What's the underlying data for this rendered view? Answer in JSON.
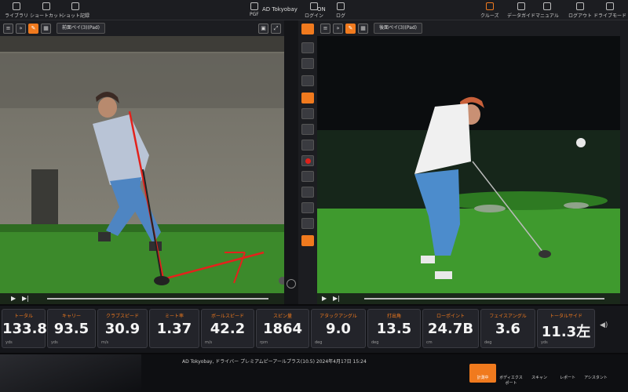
{
  "topbar": {
    "left_items": [
      {
        "label": "ライブラリ",
        "icon": "library-icon"
      },
      {
        "label": "ショートカット",
        "icon": "shortcut-icon"
      },
      {
        "label": "ショット記録",
        "icon": "record-icon"
      }
    ],
    "center_items": [
      {
        "label": "PGF",
        "icon": "profile-icon"
      },
      {
        "label": "AD Tokyobay",
        "icon": "store-icon"
      },
      {
        "label": "ログイン",
        "icon": "login-icon"
      },
      {
        "label": "ON",
        "icon": "on-icon"
      },
      {
        "label": "ログ",
        "icon": "log-icon"
      }
    ],
    "right_items": [
      {
        "label": "クルーズ",
        "icon": "cruise-icon"
      },
      {
        "label": "データガイド",
        "icon": "data-guide-icon"
      },
      {
        "label": "マニュアル",
        "icon": "manual-icon"
      },
      {
        "label": "ログアウト",
        "icon": "logout-icon"
      },
      {
        "label": "ドライブモード",
        "icon": "drive-mode-icon"
      }
    ]
  },
  "left_video": {
    "selector": "前面ペイ(3)(Pad)"
  },
  "right_video": {
    "selector": "後面ペイ(3)(Pad)"
  },
  "metrics": [
    {
      "label": "トータル",
      "value": "133.8",
      "unit": "yds"
    },
    {
      "label": "キャリー",
      "value": "93.5",
      "unit": "yds"
    },
    {
      "label": "クラブスピード",
      "value": "30.9",
      "unit": "m/s"
    },
    {
      "label": "ミート率",
      "value": "1.37",
      "unit": ""
    },
    {
      "label": "ボールスピード",
      "value": "42.2",
      "unit": "m/s"
    },
    {
      "label": "スピン量",
      "value": "1864",
      "unit": "rpm"
    },
    {
      "label": "アタックアングル",
      "value": "9.0",
      "unit": "deg"
    },
    {
      "label": "打出角",
      "value": "13.5",
      "unit": "deg"
    },
    {
      "label": "ローポイント",
      "value": "24.7B",
      "unit": "cm"
    },
    {
      "label": "フェイスアングル",
      "value": "3.6",
      "unit": "deg"
    },
    {
      "label": "トータルサイド",
      "value": "11.3左",
      "unit": "yds"
    }
  ],
  "footer": {
    "status": "AD Tokyobay, ドライバー プレミアムピーアールプラス(10.5) 2024年4月17日 15:24",
    "buttons": [
      {
        "label": "計測中",
        "icon": "measure-icon"
      },
      {
        "label": "ボディエクスポート",
        "icon": "export-icon"
      },
      {
        "label": "スキャン",
        "icon": "scan-icon"
      },
      {
        "label": "レポート",
        "icon": "report-icon"
      },
      {
        "label": "アシスタント",
        "icon": "assistant-icon"
      }
    ]
  },
  "colors": {
    "accent": "#f07a1e",
    "panel": "#1c1d21"
  }
}
